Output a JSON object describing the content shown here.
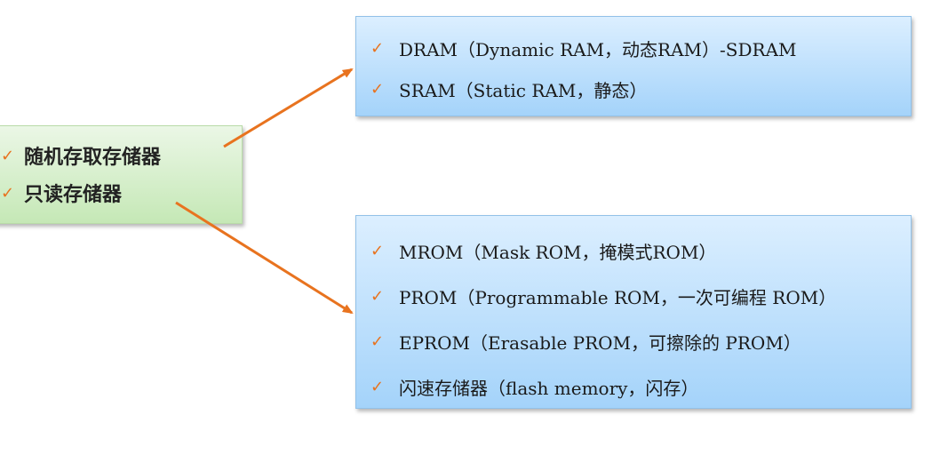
{
  "root": {
    "items": [
      "随机存取存储器",
      "只读存储器"
    ]
  },
  "ram_types": {
    "items": [
      "DRAM（Dynamic RAM，动态RAM）-SDRAM",
      "SRAM（Static RAM，静态）"
    ]
  },
  "rom_types": {
    "items": [
      "MROM（Mask ROM，掩模式ROM）",
      "PROM（Programmable ROM，一次可编程 ROM）",
      "EPROM（Erasable PROM，可擦除的 PROM）",
      "闪速存储器（flash memory，闪存）"
    ]
  },
  "check_glyph": "✓",
  "colors": {
    "arrow": "#e8731f",
    "check": "#e8731f",
    "green_box": "#c5e8b6",
    "blue_box": "#a4d3fa"
  }
}
